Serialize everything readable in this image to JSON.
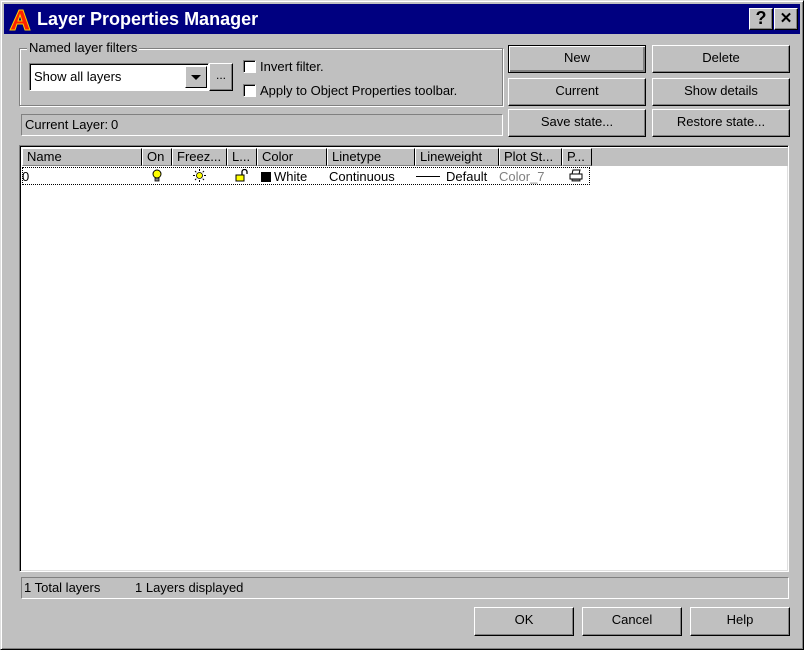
{
  "window": {
    "title": "Layer Properties Manager",
    "help_button": "?",
    "close_button": "✕"
  },
  "filters": {
    "group_label": "Named layer filters",
    "selected_filter": "Show all layers",
    "browse_label": "...",
    "invert_filter_label": "Invert filter.",
    "invert_filter_checked": false,
    "apply_toolbar_label": "Apply to Object Properties toolbar.",
    "apply_toolbar_checked": false
  },
  "current_layer": {
    "label": "Current Layer:",
    "value": "0"
  },
  "buttons": {
    "new": "New",
    "delete": "Delete",
    "current": "Current",
    "show_details": "Show details",
    "save_state": "Save state...",
    "restore_state": "Restore state..."
  },
  "layer_list": {
    "columns": [
      "Name",
      "On",
      "Freez...",
      "L...",
      "Color",
      "Linetype",
      "Lineweight",
      "Plot St...",
      "P..."
    ],
    "rows": [
      {
        "name": "0",
        "on": "lightbulb-on",
        "freeze": "sun-thawed",
        "lock": "padlock-unlocked",
        "color": "White",
        "color_hex": "#000000",
        "linetype": "Continuous",
        "lineweight": "Default",
        "plot_style": "Color_7",
        "plot": "printer"
      }
    ]
  },
  "status_bar": {
    "total_layers": "1 Total layers",
    "layers_displayed": "1 Layers displayed"
  },
  "dialog_buttons": {
    "ok": "OK",
    "cancel": "Cancel",
    "help": "Help"
  },
  "colors": {
    "titlebar": "#000080",
    "face": "#c0c0c0",
    "icon_yellow": "#ffff00",
    "plot_style_gray": "#808080"
  }
}
